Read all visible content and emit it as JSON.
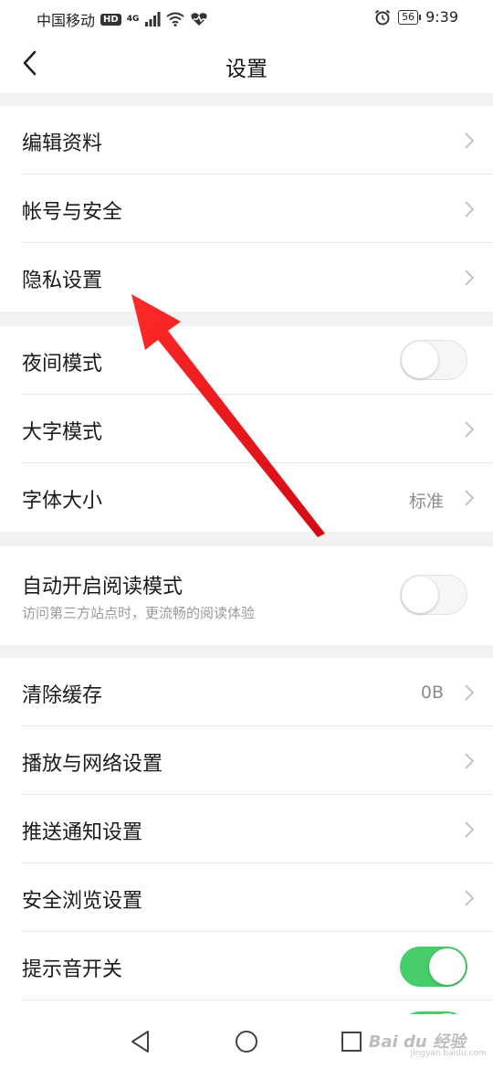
{
  "status_bar": {
    "carrier": "中国移动",
    "hd_badge": "HD",
    "network_badge": "4G",
    "battery": "56",
    "time": "9:39"
  },
  "header": {
    "title": "设置"
  },
  "groups": [
    {
      "items": [
        {
          "label": "编辑资料",
          "control": "chevron"
        },
        {
          "label": "帐号与安全",
          "control": "chevron"
        },
        {
          "label": "隐私设置",
          "control": "chevron"
        }
      ]
    },
    {
      "items": [
        {
          "label": "夜间模式",
          "control": "toggle",
          "on": false
        },
        {
          "label": "大字模式",
          "control": "chevron"
        },
        {
          "label": "字体大小",
          "control": "chevron",
          "value": "标准"
        }
      ]
    },
    {
      "items": [
        {
          "label": "自动开启阅读模式",
          "sub": "访问第三方站点时，更流畅的阅读体验",
          "control": "toggle",
          "on": false
        }
      ]
    },
    {
      "items": [
        {
          "label": "清除缓存",
          "control": "chevron",
          "value": "0B"
        },
        {
          "label": "播放与网络设置",
          "control": "chevron"
        },
        {
          "label": "推送通知设置",
          "control": "chevron"
        },
        {
          "label": "安全浏览设置",
          "control": "chevron"
        },
        {
          "label": "提示音开关",
          "control": "toggle",
          "on": true
        }
      ]
    }
  ],
  "watermark": {
    "brand": "Bai du 经验",
    "url": "jingyan.baidu.com"
  },
  "colors": {
    "toggle_on": "#47cc6a",
    "annotation_arrow": "#e8101a",
    "background": "#f2f2f2"
  }
}
